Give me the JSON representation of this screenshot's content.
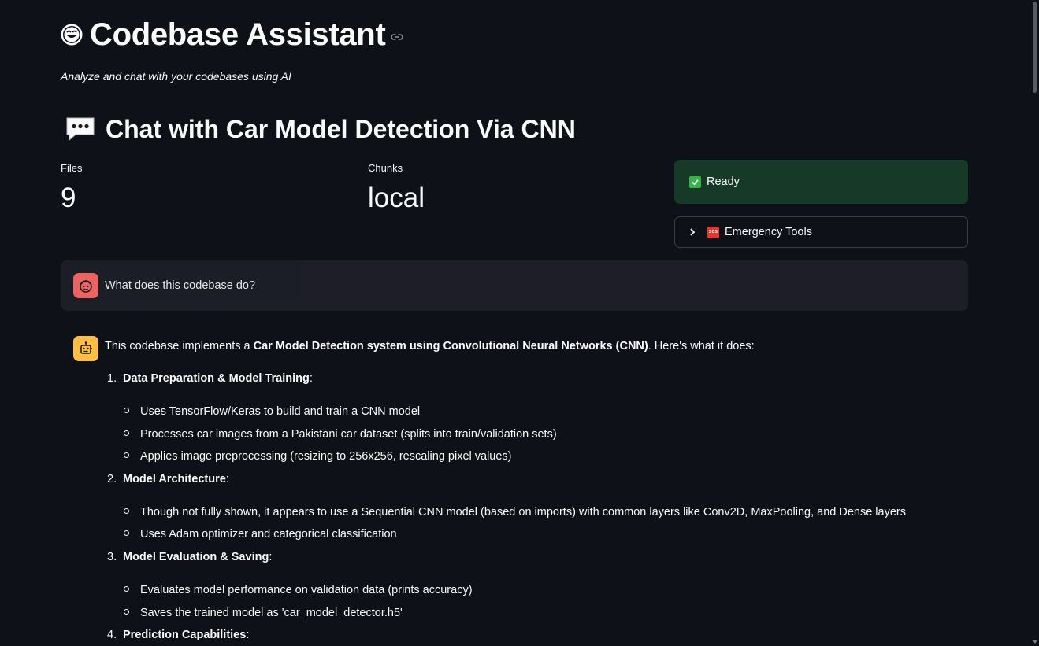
{
  "header": {
    "title": "Codebase Assistant",
    "subtitle": "Analyze and chat with your codebases using AI",
    "title_icon": "smiling-face-icon",
    "anchor_icon": "link-icon"
  },
  "chat_header": {
    "title": "Chat with Car Model Detection Via CNN",
    "icon": "speech-bubble-icon"
  },
  "metrics": [
    {
      "label": "Files",
      "value": "9"
    },
    {
      "label": "Chunks",
      "value": "local"
    }
  ],
  "status": {
    "text": "Ready",
    "icon": "check-mark-icon",
    "color": "#173928"
  },
  "emergency": {
    "label": "Emergency Tools",
    "icon": "sos-icon"
  },
  "messages": {
    "user_question": "What does this codebase do?",
    "bot": {
      "intro_pre": "This codebase implements a ",
      "intro_bold": "Car Model Detection system using Convolutional Neural Networks (CNN)",
      "intro_post": ". Here's what it does:",
      "sections": [
        {
          "num": "1.",
          "title": "Data Preparation & Model Training",
          "items": [
            "Uses TensorFlow/Keras to build and train a CNN model",
            "Processes car images from a Pakistani car dataset (splits into train/validation sets)",
            "Applies image preprocessing (resizing to 256x256, rescaling pixel values)"
          ]
        },
        {
          "num": "2.",
          "title": "Model Architecture",
          "items": [
            "Though not fully shown, it appears to use a Sequential CNN model (based on imports) with common layers like Conv2D, MaxPooling, and Dense layers",
            "Uses Adam optimizer and categorical classification"
          ]
        },
        {
          "num": "3.",
          "title": "Model Evaluation & Saving",
          "items": [
            "Evaluates model performance on validation data (prints accuracy)",
            "Saves the trained model as 'car_model_detector.h5'"
          ]
        },
        {
          "num": "4.",
          "title": "Prediction Capabilities",
          "items": []
        }
      ]
    }
  },
  "colors": {
    "background": "#0e1117",
    "user_avatar": "#ff6b6b",
    "bot_avatar": "#ffbd45"
  }
}
